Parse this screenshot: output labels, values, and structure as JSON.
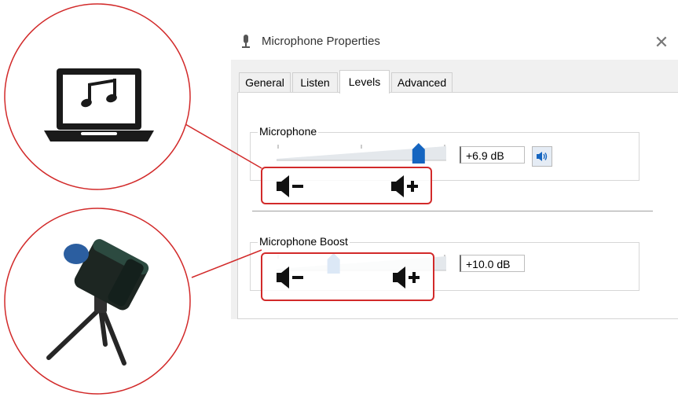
{
  "window": {
    "title": "Microphone Properties",
    "close_glyph": "✕",
    "title_icon": "microphone-icon"
  },
  "tabs": [
    {
      "label": "General",
      "active": false
    },
    {
      "label": "Listen",
      "active": false
    },
    {
      "label": "Levels",
      "active": true
    },
    {
      "label": "Advanced",
      "active": false
    }
  ],
  "microphone": {
    "label": "Microphone",
    "value_text": "+6.9 dB",
    "slider_fraction": 0.85,
    "mute_icon": "speaker-on-icon"
  },
  "boost": {
    "label": "Microphone Boost",
    "value_text": "+10.0 dB",
    "slider_fraction": 0.33
  },
  "callout_icons": [
    "volume-down-icon",
    "volume-up-icon"
  ],
  "illustrations": [
    "laptop-music-icon",
    "usb-microphone-on-tripod"
  ],
  "colors": {
    "accent": "#1565c0",
    "callout": "#d22a2a",
    "dialog_bg": "#f0f0f0"
  }
}
